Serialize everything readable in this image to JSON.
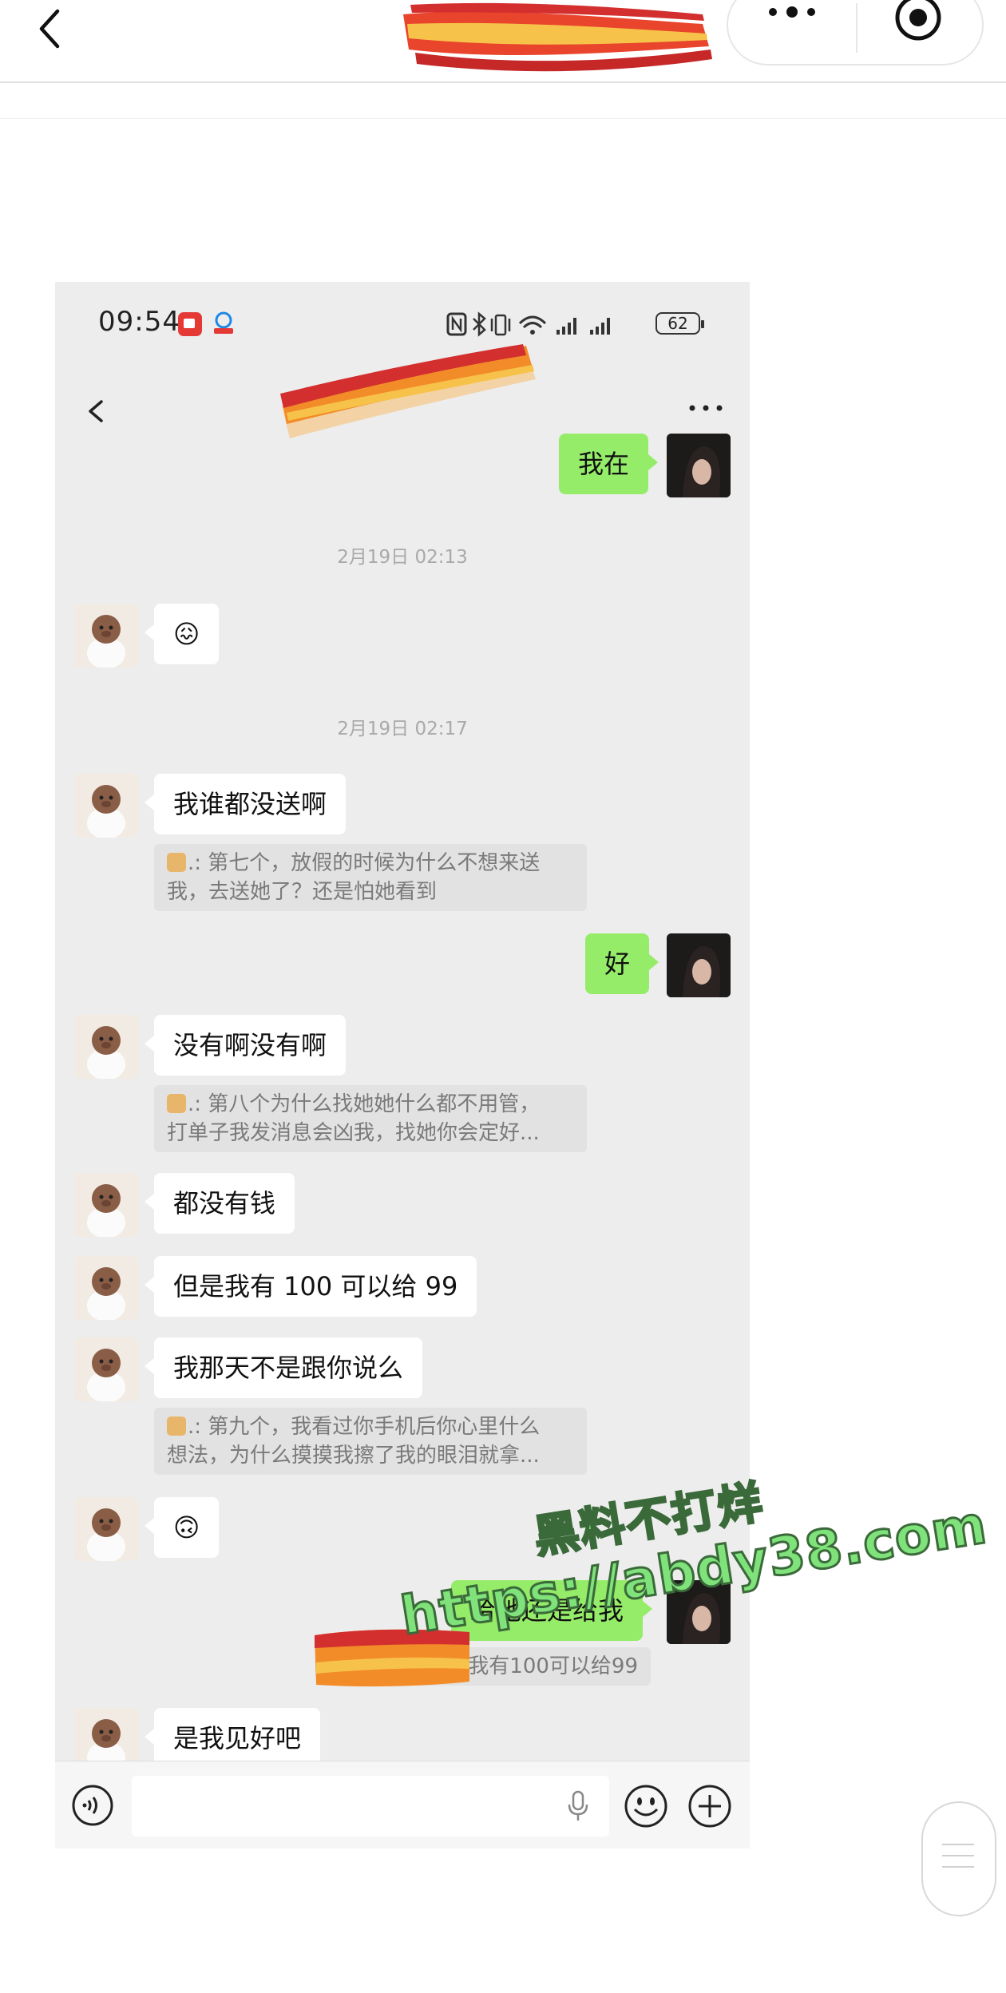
{
  "outer_nav": {
    "back_icon": "chevron-left-icon",
    "more_icon": "more-dots-icon",
    "target_icon": "record-circle-icon"
  },
  "status_bar": {
    "time": "09:54",
    "battery": "62"
  },
  "chat": {
    "more_icon": "more-dots-icon",
    "messages": [
      {
        "side": "out",
        "text": "我在"
      },
      {
        "type": "time",
        "text": "2月19日 02:13"
      },
      {
        "side": "in",
        "text": "😖"
      },
      {
        "type": "time",
        "text": "2月19日 02:17"
      },
      {
        "side": "in",
        "text": "我谁都没送啊",
        "quote_line1": ".: 第七个，放假的时候为什么不想来送",
        "quote_line2": "我，去送她了？还是怕她看到"
      },
      {
        "side": "out",
        "text": "好"
      },
      {
        "side": "in",
        "text": "没有啊没有啊",
        "quote_line1": ".: 第八个为什么找她她什么都不用管，",
        "quote_line2": "打单子我发消息会凶我，找她你会定好..."
      },
      {
        "side": "in",
        "text": "都没有钱"
      },
      {
        "side": "in",
        "text": "但是我有 100 可以给 99"
      },
      {
        "side": "in",
        "text": "我那天不是跟你说么",
        "quote_line1": ".: 第九个，我看过你手机后你心里什么",
        "quote_line2": "想法，为什么摸摸我擦了我的眼泪就拿..."
      },
      {
        "side": "in",
        "text": "🙃"
      },
      {
        "side": "out",
        "text": "给她还是给我",
        "quote_line1": "我有100可以给99"
      },
      {
        "side": "in",
        "text": "是我见好吧"
      }
    ]
  },
  "input_bar": {
    "voice_icon": "voice-icon",
    "mic_icon": "mic-icon",
    "emoji_icon": "emoji-icon",
    "plus_icon": "plus-icon"
  },
  "watermark": {
    "line1": "黑料不打烊",
    "line2": "https://abdy38.com"
  },
  "colors": {
    "outgoing_bubble": "#95ec69",
    "incoming_bubble": "#ffffff",
    "chat_background": "#ededed",
    "watermark_green": "#7fe27a"
  }
}
